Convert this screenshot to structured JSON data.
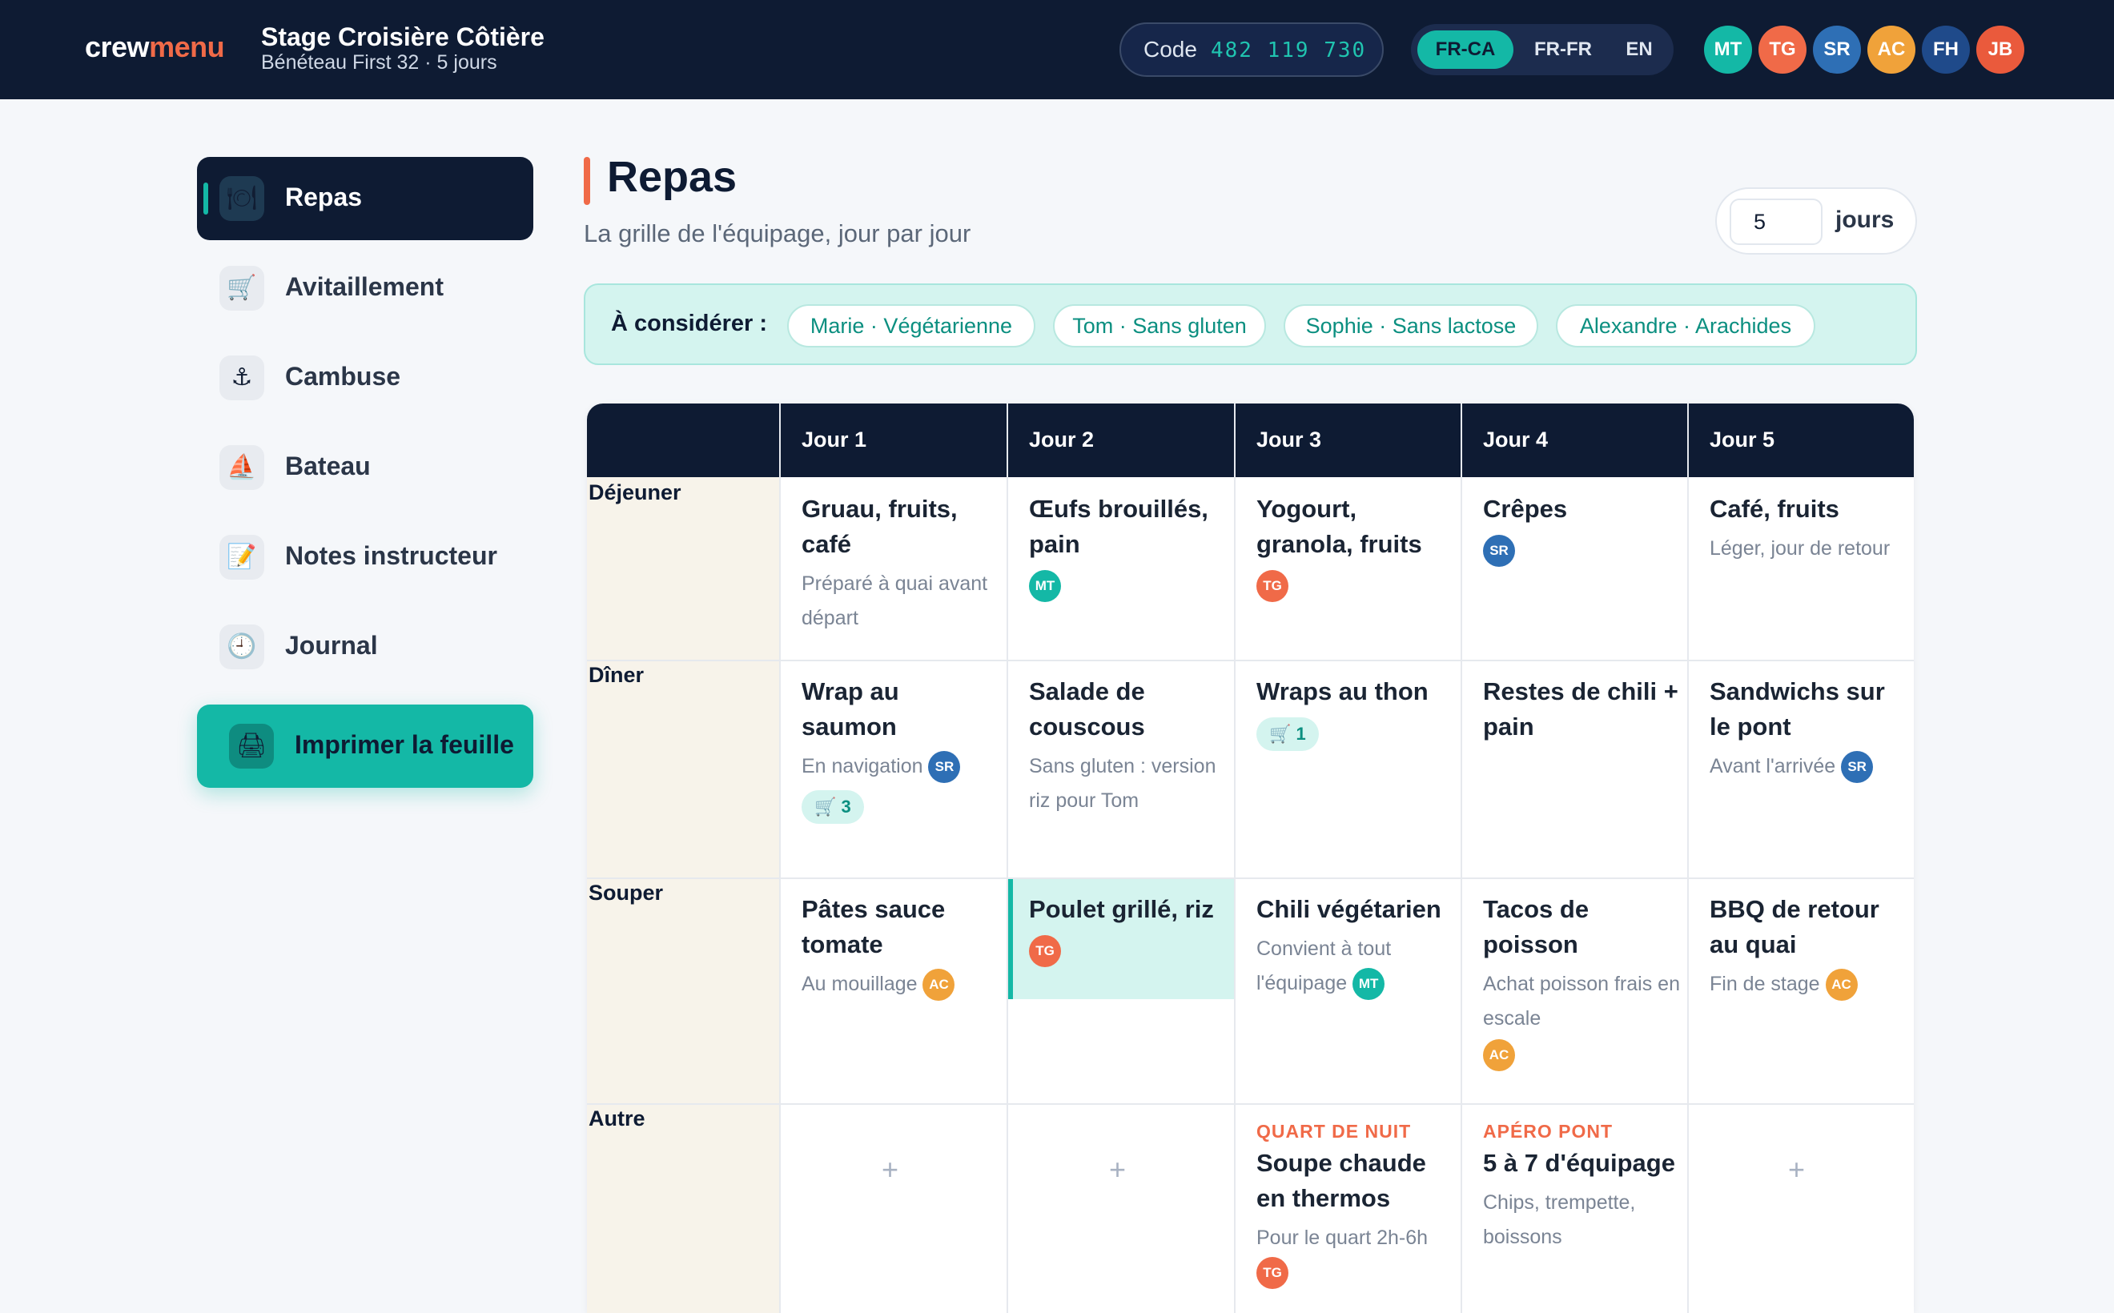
{
  "header": {
    "logo_a": "crew",
    "logo_b": "menu",
    "trip_title": "Stage Croisière Côtière",
    "trip_sub": "Bénéteau First 32 · 5 jours",
    "code_label": "Code",
    "code_value": "482 119 730",
    "langs": [
      "FR-CA",
      "FR-FR",
      "EN"
    ],
    "active_lang": "FR-CA",
    "avatars": [
      {
        "initials": "MT",
        "color": "#14b8a6"
      },
      {
        "initials": "TG",
        "color": "#f06a48"
      },
      {
        "initials": "SR",
        "color": "#2e6fb5"
      },
      {
        "initials": "AC",
        "color": "#f0a23a"
      },
      {
        "initials": "FH",
        "color": "#1f4a8a"
      },
      {
        "initials": "JB",
        "color": "#ea5a3c"
      }
    ]
  },
  "sidebar": {
    "items": [
      {
        "label": "Repas",
        "icon": "plate-icon",
        "glyph": "🍽"
      },
      {
        "label": "Avitaillement",
        "icon": "cart-icon",
        "glyph": "🛒"
      },
      {
        "label": "Cambuse",
        "icon": "anchor-icon",
        "glyph": "⚓"
      },
      {
        "label": "Bateau",
        "icon": "sailboat-icon",
        "glyph": "⛵"
      },
      {
        "label": "Notes instructeur",
        "icon": "memo-icon",
        "glyph": "📝"
      },
      {
        "label": "Journal",
        "icon": "clock-icon",
        "glyph": "🕘"
      }
    ],
    "print_label": "Imprimer la feuille",
    "print_glyph": "🖨"
  },
  "main": {
    "title": "Repas",
    "subtitle": "La grille de l'équipage, jour par jour",
    "days_value": "5",
    "days_label": "jours",
    "consider_label": "À considérer :",
    "chips": [
      "Marie · Végétarienne",
      "Tom · Sans gluten",
      "Sophie · Sans lactose",
      "Alexandre · Arachides"
    ]
  },
  "grid": {
    "columns": [
      "Jour 1",
      "Jour 2",
      "Jour 3",
      "Jour 4",
      "Jour 5"
    ],
    "rows": [
      "Déjeuner",
      "Dîner",
      "Souper",
      "Autre"
    ],
    "add_glyph": "+",
    "cart_glyph": "🛒",
    "cells": {
      "r0c0": {
        "title": "Gruau, fruits, café",
        "note": "Préparé à quai avant départ"
      },
      "r0c1": {
        "title": "Œufs brouillés, pain",
        "avatar": "MT"
      },
      "r0c2": {
        "title": "Yogourt, granola, fruits",
        "avatar": "TG"
      },
      "r0c3": {
        "title": "Crêpes",
        "avatar": "SR"
      },
      "r0c4": {
        "title": "Café, fruits",
        "note": "Léger, jour de retour"
      },
      "r1c0": {
        "title": "Wrap au saumon",
        "note": "En navigation",
        "avatar": "SR",
        "cart": "3"
      },
      "r1c1": {
        "title": "Salade de couscous",
        "note": "Sans gluten : version riz pour Tom"
      },
      "r1c2": {
        "title": "Wraps au thon",
        "cart": "1"
      },
      "r1c3": {
        "title": "Restes de chili + pain"
      },
      "r1c4": {
        "title": "Sandwichs sur le pont",
        "note": "Avant l'arrivée",
        "avatar": "SR"
      },
      "r2c0": {
        "title": "Pâtes sauce tomate",
        "note": "Au mouillage",
        "avatar": "AC"
      },
      "r2c1": {
        "title": "Poulet grillé, riz",
        "avatar": "TG"
      },
      "r2c2": {
        "title": "Chili végétarien",
        "note": "Convient à tout l'équipage",
        "avatar": "MT"
      },
      "r2c3": {
        "title": "Tacos de poisson",
        "note": "Achat poisson frais en escale",
        "avatar": "AC"
      },
      "r2c4": {
        "title": "BBQ de retour au quai",
        "note": "Fin de stage",
        "avatar": "AC"
      },
      "r3c2": {
        "tag": "QUART DE NUIT",
        "title": "Soupe chaude en thermos",
        "note": "Pour le quart 2h-6h",
        "avatar": "TG"
      },
      "r3c3": {
        "tag": "APÉRO PONT",
        "title": "5 à 7 d'équipage",
        "note": "Chips, trempette, boissons"
      }
    }
  }
}
